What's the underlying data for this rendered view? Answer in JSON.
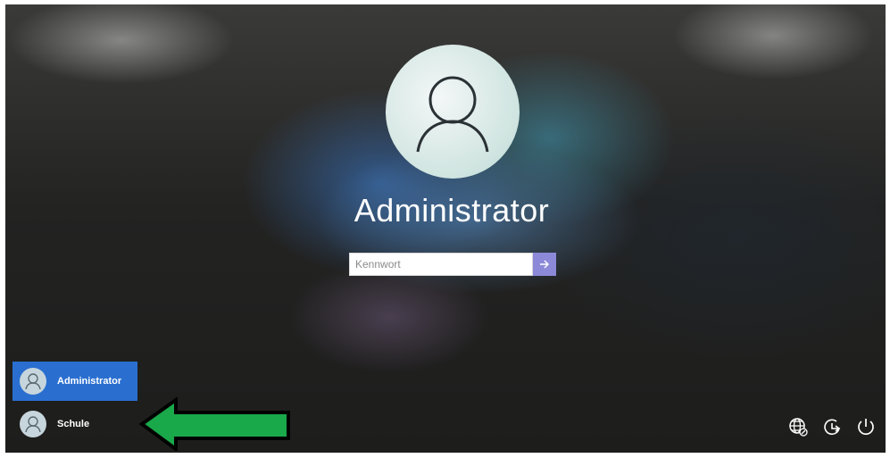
{
  "login": {
    "selected_user": "Administrator",
    "password_placeholder": "Kennwort",
    "password_value": ""
  },
  "user_list": [
    {
      "name": "Administrator",
      "selected": true
    },
    {
      "name": "Schule",
      "selected": false
    }
  ],
  "system_icons": [
    "network-icon",
    "ease-of-access-icon",
    "power-icon"
  ],
  "colors": {
    "selected_user_bg": "#2a6fd0",
    "submit_button": "#8c8ad8",
    "annotation_arrow_fill": "#19a84a"
  }
}
